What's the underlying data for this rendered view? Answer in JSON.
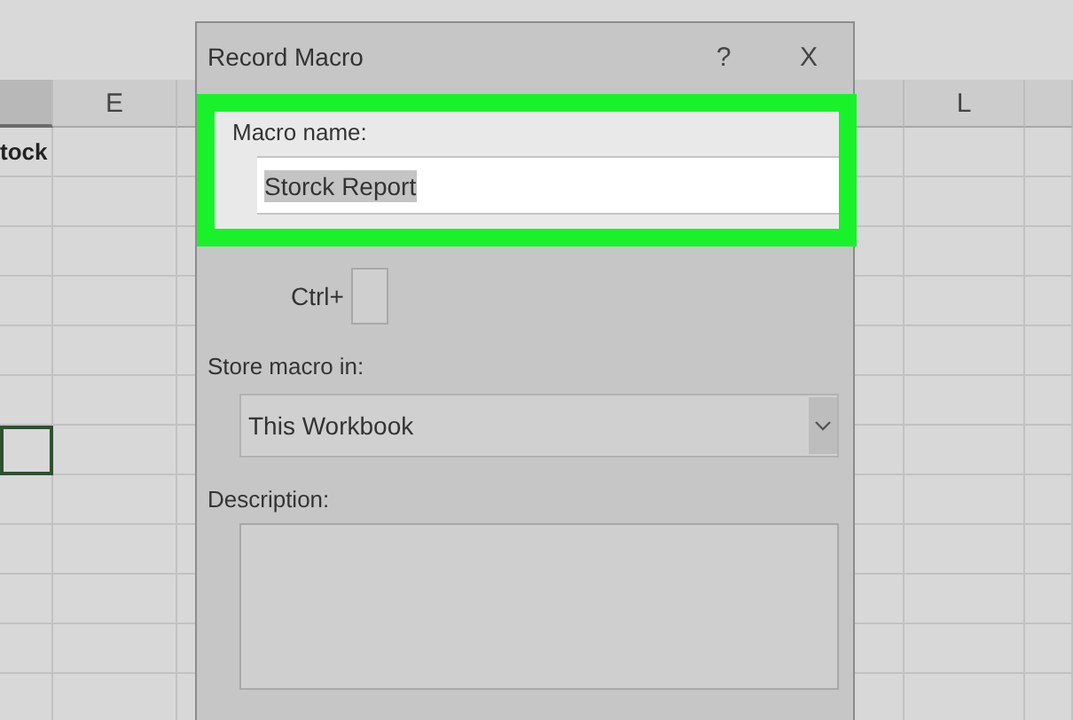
{
  "sheet": {
    "column_headers": [
      {
        "label": "E"
      },
      {
        "label": "L"
      }
    ],
    "cells": [
      {
        "text": "tock",
        "bold": true
      }
    ],
    "active_cell": {
      "selected": true
    }
  },
  "dialog": {
    "title": "Record Macro",
    "help": "?",
    "close": "X",
    "macro_name": {
      "label": "Macro name:",
      "value": "Storck Report",
      "value_selected": true,
      "highlighted": true
    },
    "shortcut": {
      "prefix": "Ctrl+"
    },
    "store_in": {
      "label": "Store macro in:",
      "value": "This Workbook"
    },
    "description": {
      "label": "Description:"
    }
  }
}
